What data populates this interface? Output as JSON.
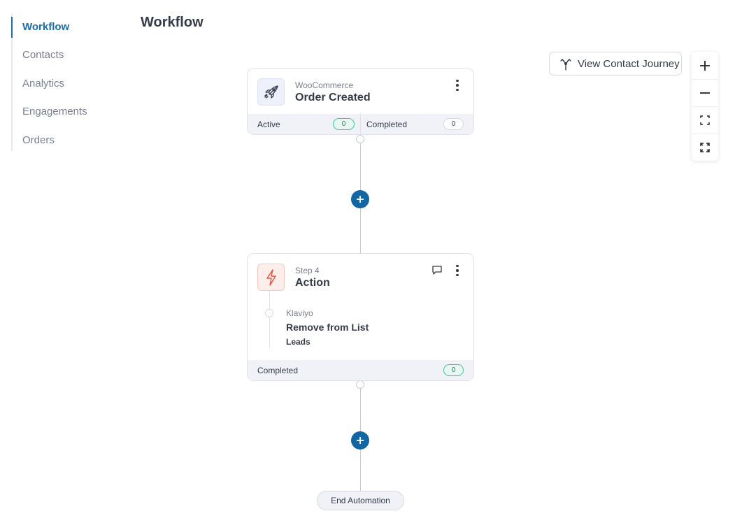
{
  "sidebar": {
    "items": [
      {
        "label": "Workflow",
        "active": true
      },
      {
        "label": "Contacts"
      },
      {
        "label": "Analytics"
      },
      {
        "label": "Engagements"
      },
      {
        "label": "Orders"
      }
    ]
  },
  "page": {
    "title": "Workflow"
  },
  "toolbar": {
    "journey_label": "View Contact Journey",
    "journey_icon": "branch-icon",
    "zoom_icons": [
      "plus-icon",
      "minus-icon",
      "fit-view-icon",
      "fullscreen-icon"
    ]
  },
  "trigger_card": {
    "icon": "rocket-icon",
    "subtitle": "WooCommerce",
    "title": "Order Created",
    "active_label": "Active",
    "active_count": "0",
    "completed_label": "Completed",
    "completed_count": "0"
  },
  "action_card": {
    "icon": "lightning-icon",
    "subtitle": "Step 4",
    "title": "Action",
    "comment_icon": "comment-icon",
    "action": {
      "provider": "Klaviyo",
      "name": "Remove from List",
      "detail": "Leads"
    },
    "completed_label": "Completed",
    "completed_count": "0"
  },
  "end": {
    "label": "End Automation"
  },
  "colors": {
    "accent": "#1166a3",
    "nav_active": "#1b6ea8",
    "success_pill": "#4dbf9c",
    "action_icon": "#e0533c",
    "action_icon_bg": "#fdeeec",
    "trigger_icon_bg": "#eef0fb"
  }
}
